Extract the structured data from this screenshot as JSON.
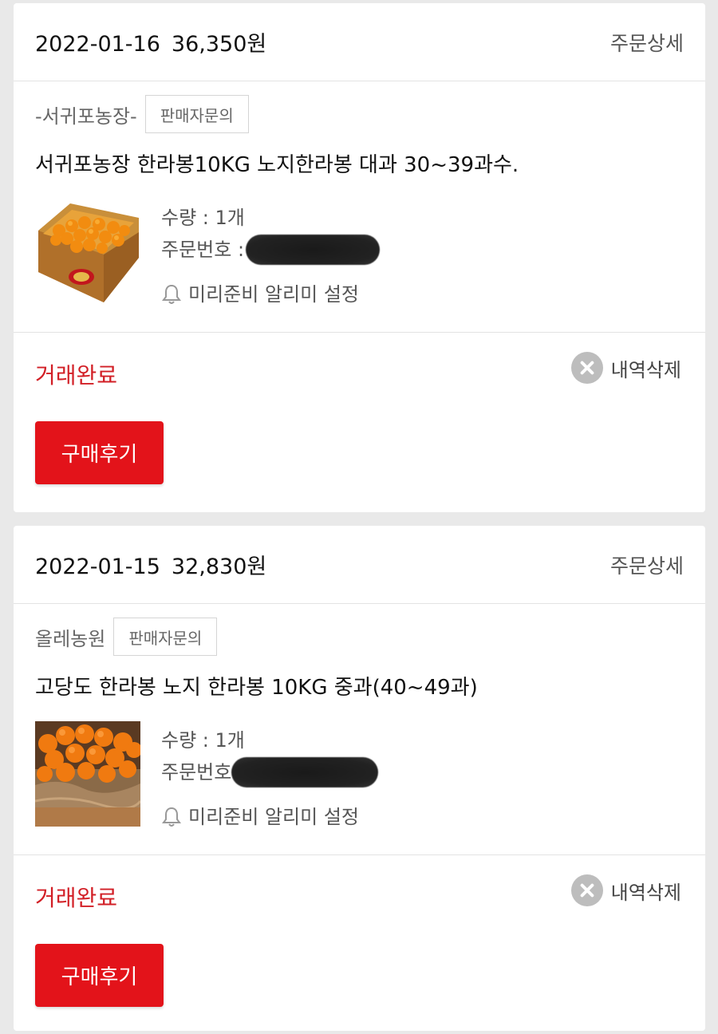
{
  "orders": [
    {
      "date": "2022-01-16",
      "price": "36,350원",
      "detail_label": "주문상세",
      "seller": "-서귀포농장-",
      "inquiry_label": "판매자문의",
      "title": "서귀포농장 한라봉10KG 노지한라봉 대과 30~39과수.",
      "quantity": "수량 : 1개",
      "order_no_label": "주문번호 :",
      "alarm_label": "미리준비 알리미 설정",
      "status": "거래완료",
      "delete_label": "내역삭제",
      "review_label": "구매후기"
    },
    {
      "date": "2022-01-15",
      "price": "32,830원",
      "detail_label": "주문상세",
      "seller": "올레농원",
      "inquiry_label": "판매자문의",
      "title": "고당도 한라봉 노지 한라봉 10KG 중과(40~49과)",
      "quantity": "수량 : 1개",
      "order_no_label": "주문번호",
      "alarm_label": "미리준비 알리미 설정",
      "status": "거래완료",
      "delete_label": "내역삭제",
      "review_label": "구매후기"
    }
  ],
  "colors": {
    "status_red": "#d21f26",
    "button_red": "#e3131a",
    "background": "#e9e9e9"
  },
  "icons": [
    "bell-icon",
    "close-circle-icon"
  ]
}
